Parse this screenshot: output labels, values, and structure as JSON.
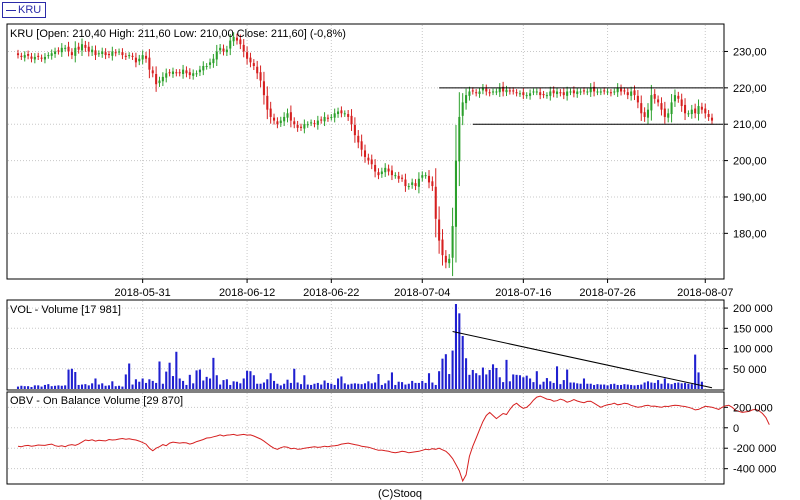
{
  "legend": {
    "label": "KRU",
    "color": "#2b2ba8"
  },
  "footer": {
    "credit": "(C)Stooq"
  },
  "colors": {
    "up": "#2ca02c",
    "down": "#d62020",
    "volume": "#2020d0",
    "obv": "#d62020",
    "grid": "#c8c8c8",
    "frame": "#000000"
  },
  "chart_data": [
    {
      "type": "candlestick",
      "title": "KRU [Open: 210,40  High: 211,60  Low: 210,00  Close: 211,60] (-0,8%)",
      "x_tick_labels": [
        "2018-05-31",
        "2018-06-12",
        "2018-06-22",
        "2018-07-04",
        "2018-07-16",
        "2018-07-26",
        "2018-08-07"
      ],
      "y_tick_labels": [
        "180,00",
        "190,00",
        "200,00",
        "210,00",
        "220,00",
        "230,00"
      ],
      "y_ticks": [
        180,
        190,
        200,
        210,
        220,
        230
      ],
      "ylim": [
        168,
        237
      ],
      "closes": [
        229,
        228.5,
        229,
        228.8,
        228,
        228.5,
        228.5,
        228,
        228.5,
        229,
        229.5,
        230,
        230,
        231,
        231,
        230,
        229,
        231,
        230.5,
        232,
        231,
        230,
        230.5,
        229,
        229.5,
        230,
        229,
        229,
        230,
        229.5,
        230,
        229,
        228.5,
        229,
        228.5,
        227,
        228,
        229,
        228,
        225,
        224,
        221,
        222,
        223,
        224,
        224,
        224.5,
        224,
        224,
        225,
        224,
        223.5,
        224,
        224,
        225,
        226,
        226,
        227,
        228,
        230,
        231,
        230,
        230.5,
        233,
        234,
        233,
        232,
        230,
        228,
        227,
        226,
        224,
        222,
        218,
        214,
        212,
        211,
        210,
        211,
        212,
        213,
        211,
        210,
        209,
        209,
        210,
        210,
        210.5,
        210,
        211,
        211,
        212,
        211.5,
        212,
        213,
        213.5,
        213,
        213,
        212,
        210,
        207,
        205,
        203,
        201,
        200,
        199,
        197,
        196,
        197,
        198,
        197,
        196,
        196,
        195,
        195,
        193,
        193,
        194,
        193,
        195,
        196,
        196,
        194,
        193,
        184,
        178,
        174,
        172,
        173,
        182,
        200,
        212,
        216,
        218,
        219,
        219,
        218.5,
        219,
        220,
        219,
        218.5,
        219,
        219,
        220,
        219,
        219.5,
        219,
        219,
        218.5,
        218.5,
        218,
        218,
        218.5,
        219,
        219,
        218,
        218,
        218,
        219,
        218.5,
        219,
        218.5,
        218,
        219,
        219,
        218.5,
        219,
        219,
        219,
        219,
        220,
        219,
        219,
        219,
        219,
        219,
        218.5,
        219,
        220,
        219,
        219,
        218,
        219,
        218,
        216,
        213,
        212,
        214,
        218,
        217,
        216,
        214,
        212,
        213,
        216,
        218,
        217,
        215,
        213,
        213,
        214,
        213,
        215,
        214,
        213,
        212,
        211
      ],
      "annotations": [
        {
          "kind": "hline",
          "y": 220,
          "from_index": 125
        },
        {
          "kind": "hline",
          "y": 210,
          "from_index": 135
        }
      ]
    },
    {
      "type": "bar",
      "title": "VOL - Volume [17 981]",
      "y_tick_labels": [
        "50 000",
        "100 000",
        "150 000",
        "200 000"
      ],
      "y_ticks": [
        50000,
        100000,
        150000,
        200000
      ],
      "ylim": [
        0,
        215000
      ],
      "values": [
        6000,
        8000,
        7000,
        7000,
        5000,
        9000,
        9000,
        6000,
        10000,
        12000,
        7000,
        8000,
        9000,
        8000,
        9000,
        48000,
        50000,
        42000,
        10000,
        11000,
        12000,
        9000,
        14000,
        26000,
        11000,
        14000,
        8000,
        9000,
        19000,
        7000,
        8000,
        6000,
        36000,
        63000,
        11000,
        24000,
        18000,
        26000,
        15000,
        24000,
        20000,
        15000,
        68000,
        13000,
        43000,
        65000,
        32000,
        92000,
        26000,
        20000,
        10000,
        35000,
        14000,
        46000,
        48000,
        21000,
        30000,
        26000,
        77000,
        34000,
        11000,
        22000,
        24000,
        10000,
        19000,
        18000,
        14000,
        26000,
        45000,
        44000,
        34000,
        13000,
        13000,
        16000,
        24000,
        39000,
        20000,
        13000,
        9000,
        13000,
        23000,
        15000,
        50000,
        16000,
        12000,
        34000,
        11000,
        10000,
        13000,
        15000,
        11000,
        21000,
        15000,
        13000,
        10000,
        26000,
        31000,
        14000,
        11000,
        13000,
        14000,
        13000,
        12000,
        14000,
        19000,
        14000,
        16000,
        37000,
        10000,
        14000,
        21000,
        41000,
        10000,
        18000,
        17000,
        11000,
        13000,
        20000,
        15000,
        15000,
        20000,
        15000,
        39000,
        16000,
        10000,
        44000,
        75000,
        86000,
        37000,
        95000,
        210000,
        187000,
        131000,
        76000,
        35000,
        47000,
        39000,
        34000,
        53000,
        36000,
        47000,
        61000,
        52000,
        29000,
        17000,
        72000,
        19000,
        36000,
        35000,
        34000,
        29000,
        33000,
        26000,
        17000,
        44000,
        11000,
        18000,
        27000,
        19000,
        15000,
        56000,
        12000,
        22000,
        48000,
        16000,
        16000,
        14000,
        13000,
        26000,
        13000,
        13000,
        10000,
        12000,
        11000,
        11000,
        9000,
        12000,
        13000,
        10000,
        10000,
        12000,
        11000,
        10000,
        9000,
        10000,
        11000,
        16000,
        19000,
        16000,
        15000,
        22000,
        13000,
        26000,
        14000,
        12000,
        15000,
        16000,
        14000,
        15000,
        13000,
        12000,
        85000,
        41000,
        18000
      ],
      "annotations": [
        {
          "kind": "trendline",
          "from": [
            129,
            142000
          ],
          "to": [
            206,
            3000
          ]
        }
      ]
    },
    {
      "type": "line",
      "title": "OBV - On Balance Volume [29 870]",
      "y_tick_labels": [
        "-400 000",
        "-200 000",
        "0",
        "200 000"
      ],
      "y_ticks": [
        -400000,
        -200000,
        0,
        200000
      ],
      "ylim": [
        -540000,
        340000
      ],
      "values": [
        -180000,
        -185000,
        -175000,
        -172000,
        -180000,
        -175000,
        -168000,
        -170000,
        -172000,
        -165000,
        -160000,
        -175000,
        -182000,
        -176000,
        -185000,
        -170000,
        -165000,
        -172000,
        -160000,
        -140000,
        -120000,
        -125000,
        -118000,
        -130000,
        -122000,
        -125000,
        -128000,
        -115000,
        -120000,
        -117000,
        -110000,
        -105000,
        -112000,
        -108000,
        -115000,
        -120000,
        -130000,
        -145000,
        -160000,
        -200000,
        -225000,
        -200000,
        -185000,
        -165000,
        -175000,
        -150000,
        -140000,
        -145000,
        -150000,
        -145000,
        -148000,
        -160000,
        -150000,
        -135000,
        -125000,
        -115000,
        -100000,
        -98000,
        -88000,
        -80000,
        -70000,
        -80000,
        -72000,
        -70000,
        -65000,
        -75000,
        -70000,
        -65000,
        -72000,
        -70000,
        -80000,
        -95000,
        -110000,
        -130000,
        -155000,
        -180000,
        -200000,
        -210000,
        -195000,
        -185000,
        -190000,
        -205000,
        -200000,
        -210000,
        -208000,
        -200000,
        -195000,
        -190000,
        -185000,
        -192000,
        -188000,
        -180000,
        -185000,
        -178000,
        -175000,
        -170000,
        -160000,
        -155000,
        -150000,
        -158000,
        -165000,
        -170000,
        -180000,
        -185000,
        -190000,
        -200000,
        -210000,
        -220000,
        -218000,
        -225000,
        -230000,
        -240000,
        -245000,
        -238000,
        -230000,
        -235000,
        -245000,
        -240000,
        -235000,
        -230000,
        -220000,
        -210000,
        -215000,
        -205000,
        -210000,
        -200000,
        -215000,
        -230000,
        -260000,
        -300000,
        -360000,
        -420000,
        -520000,
        -460000,
        -280000,
        -180000,
        -100000,
        -20000,
        60000,
        120000,
        150000,
        120000,
        90000,
        115000,
        140000,
        130000,
        180000,
        220000,
        240000,
        210000,
        190000,
        200000,
        230000,
        270000,
        300000,
        310000,
        295000,
        280000,
        275000,
        260000,
        265000,
        280000,
        270000,
        250000,
        260000,
        275000,
        262000,
        252000,
        245000,
        258000,
        260000,
        240000,
        220000,
        200000,
        215000,
        225000,
        230000,
        240000,
        225000,
        230000,
        240000,
        235000,
        220000,
        210000,
        200000,
        205000,
        215000,
        220000,
        210000,
        212000,
        205000,
        200000,
        210000,
        208000,
        215000,
        220000,
        218000,
        212000,
        208000,
        200000,
        190000,
        175000,
        180000,
        195000,
        210000,
        205000,
        200000,
        190000,
        180000,
        200000,
        215000,
        220000,
        200000,
        170000,
        160000,
        150000,
        155000,
        160000,
        175000,
        180000,
        165000,
        140000,
        100000,
        30000
      ]
    }
  ]
}
